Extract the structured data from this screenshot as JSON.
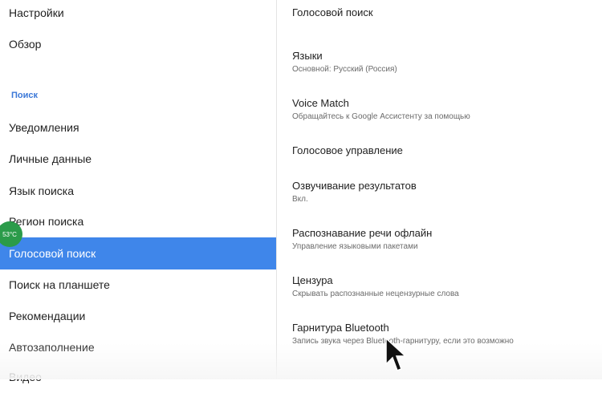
{
  "sidebar": {
    "top_items": [
      {
        "label": "Настройки"
      },
      {
        "label": "Обзор"
      }
    ],
    "section_header": "Поиск",
    "items": [
      {
        "label": "Уведомления"
      },
      {
        "label": "Личные данные"
      },
      {
        "label": "Язык поиска"
      },
      {
        "label": "Регион поиска"
      },
      {
        "label": "Голосовой поиск",
        "active": true
      },
      {
        "label": "Поиск на планшете"
      },
      {
        "label": "Рекомендации"
      },
      {
        "label": "Автозаполнение"
      },
      {
        "label": "Видео"
      }
    ],
    "active_color": "#3f86ea"
  },
  "overlay": {
    "temperature_badge": "53°C",
    "badge_color": "#2b9b4a"
  },
  "content": {
    "title": "Голосовой поиск",
    "settings": [
      {
        "title": "Языки",
        "subtitle": "Основной: Русский (Россия)"
      },
      {
        "title": "Voice Match",
        "subtitle": "Обращайтесь к Google Ассистенту за помощью"
      },
      {
        "title": "Голосовое управление",
        "subtitle": ""
      },
      {
        "title": "Озвучивание результатов",
        "subtitle": "Вкл."
      },
      {
        "title": "Распознавание речи офлайн",
        "subtitle": "Управление языковыми пакетами"
      },
      {
        "title": "Цензура",
        "subtitle": "Скрывать распознанные нецензурные слова"
      },
      {
        "title": "Гарнитура Bluetooth",
        "subtitle": "Запись звука через Bluetooth-гарнитуру, если это возможно"
      }
    ]
  }
}
